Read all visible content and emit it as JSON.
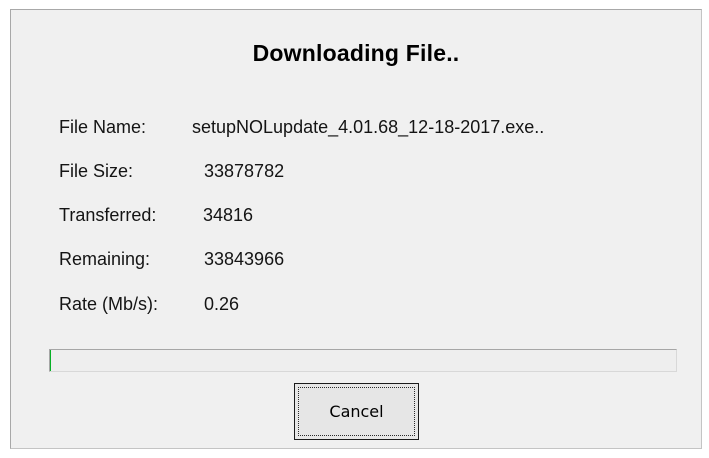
{
  "dialog": {
    "title": "Downloading File..",
    "fields": {
      "file_name": {
        "label": "File Name:",
        "value": "setupNOLupdate_4.01.68_12-18-2017.exe.."
      },
      "file_size": {
        "label": "File Size:",
        "value": "33878782"
      },
      "transferred": {
        "label": "Transferred:",
        "value": "34816"
      },
      "remaining": {
        "label": "Remaining:",
        "value": "33843966"
      },
      "rate": {
        "label": "Rate (Mb/s):",
        "value": "0.26"
      }
    },
    "progress_percent": 0.1,
    "progress_color": "#06b025",
    "cancel_label": "Cancel"
  }
}
